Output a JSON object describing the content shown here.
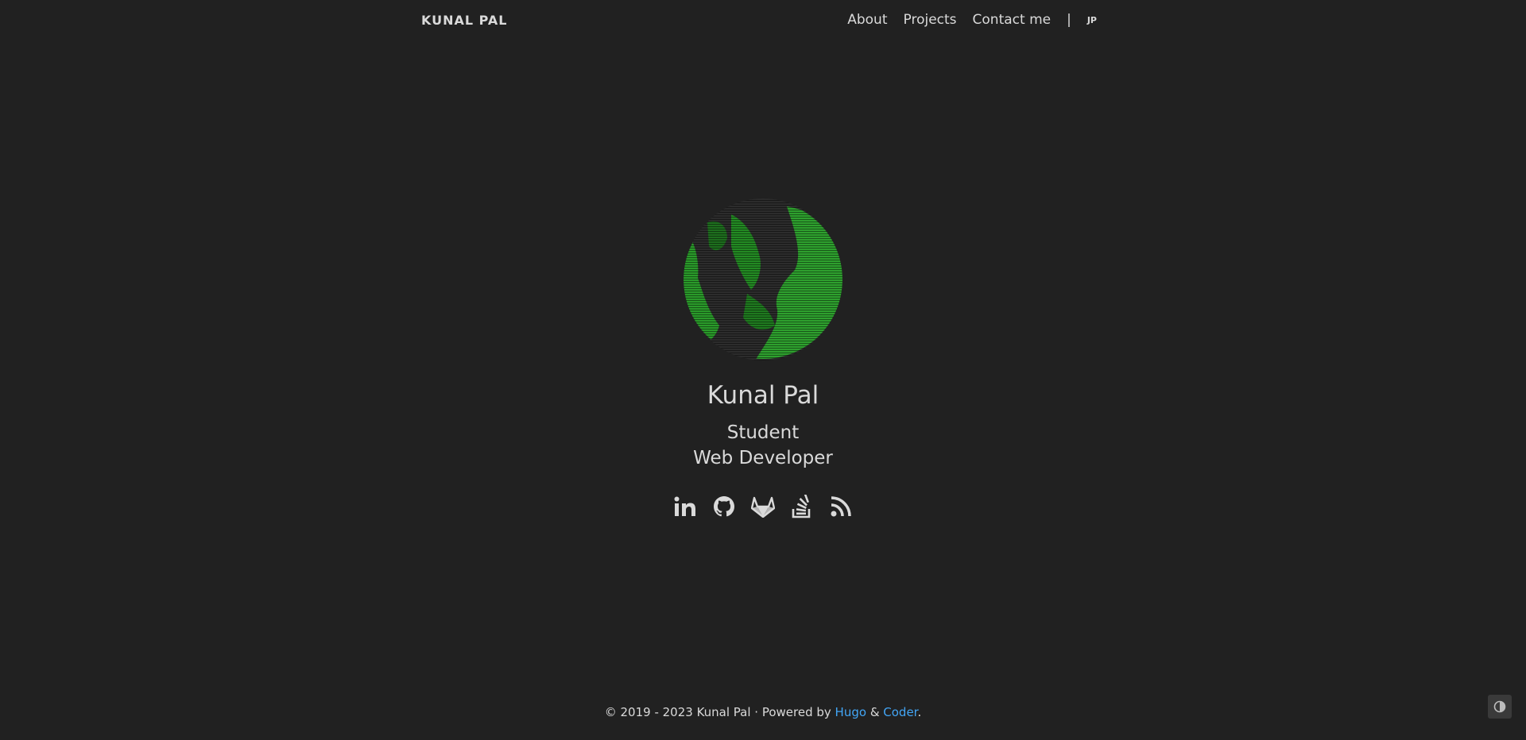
{
  "nav": {
    "brand": "KUNAL PAL",
    "links": [
      "About",
      "Projects",
      "Contact me"
    ],
    "separator": "|",
    "language": "JP"
  },
  "profile": {
    "name": "Kunal Pal",
    "roles": [
      "Student",
      "Web Developer"
    ],
    "avatar_color": "#2ea02e"
  },
  "socials": [
    {
      "icon": "linkedin-icon"
    },
    {
      "icon": "github-icon"
    },
    {
      "icon": "gitlab-icon"
    },
    {
      "icon": "stackoverflow-icon"
    },
    {
      "icon": "rss-icon"
    }
  ],
  "footer": {
    "prefix": "© 2019 - 2023 Kunal Pal · Powered by ",
    "hugo": "Hugo",
    "amp": " & ",
    "coder": "Coder",
    "suffix": "."
  },
  "colors": {
    "background": "#212121",
    "text": "#dadada",
    "link": "#42a5f5"
  },
  "theme_toggle": {
    "icon": "contrast-icon"
  }
}
